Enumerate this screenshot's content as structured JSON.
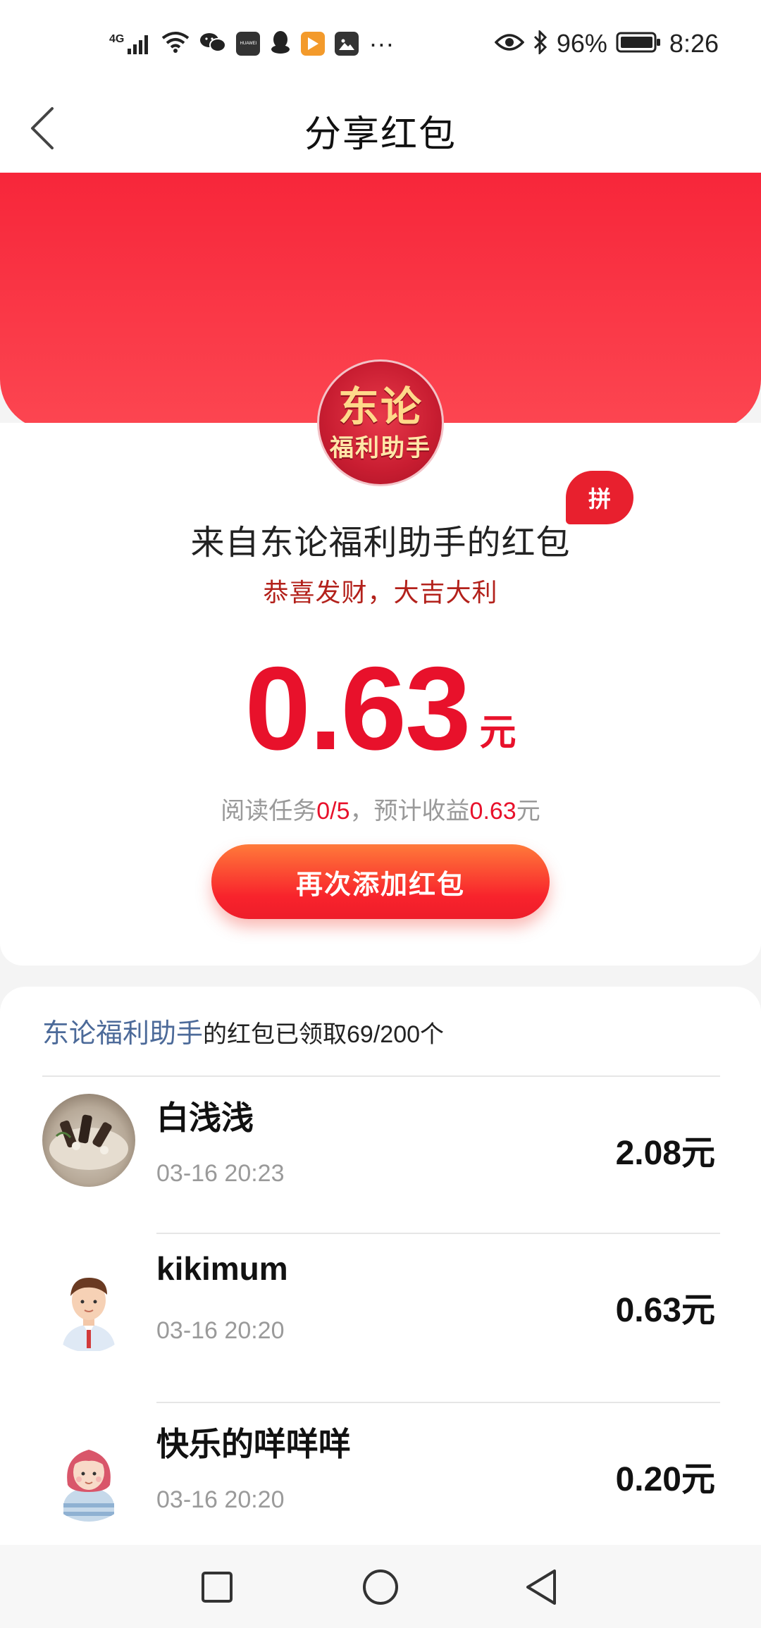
{
  "status_bar": {
    "network": "4G",
    "battery_percent": "96%",
    "time": "8:26",
    "more": "···",
    "icons": [
      "signal-icon",
      "wifi-icon",
      "wechat-icon",
      "huawei-store-icon",
      "qq-icon",
      "video-app-icon",
      "gallery-icon",
      "eye-comfort-icon",
      "bluetooth-icon",
      "battery-icon"
    ],
    "huawei_label": "HUAWEI"
  },
  "nav": {
    "title": "分享红包",
    "back_icon": "chevron-left-icon"
  },
  "colors": {
    "brand_red": "#f7263a",
    "amount_red": "#e8112b",
    "owner_blue": "#4c6a99"
  },
  "envelope": {
    "avatar_line1": "东论",
    "avatar_line2": "福利助手",
    "pin_badge": "拼",
    "from_title": "来自东论福利助手的红包",
    "blessing": "恭喜发财，大吉大利",
    "amount": "0.63",
    "unit": "元",
    "task_prefix": "阅读任务",
    "task_done": "0",
    "task_sep": "/",
    "task_total": "5",
    "task_mid": "，预计收益",
    "task_earn": "0.63",
    "task_unit": "元",
    "add_button": "再次添加红包"
  },
  "claims": {
    "owner": "东论福利助手",
    "claimed_text": "的红包已领取",
    "claimed_count": "69/200",
    "count_unit": "个",
    "rows": [
      {
        "name": "白浅浅",
        "time": "03-16 20:23",
        "amount": "2.08元"
      },
      {
        "name": "kikimum",
        "time": "03-16 20:20",
        "amount": "0.63元"
      },
      {
        "name": "快乐的咩咩咩",
        "time": "03-16 20:20",
        "amount": "0.20元"
      }
    ]
  },
  "system_nav": {
    "recent_icon": "square-icon",
    "home_icon": "circle-icon",
    "back_icon": "triangle-back-icon"
  }
}
